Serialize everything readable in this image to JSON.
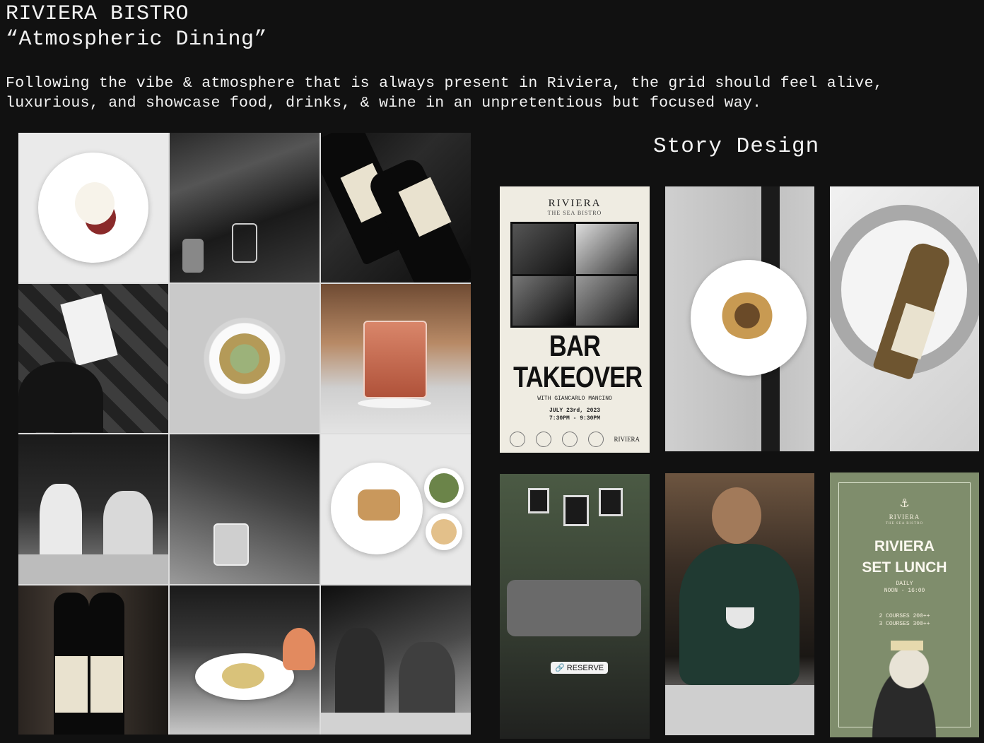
{
  "header": {
    "title": "RIVIERA BISTRO",
    "subtitle": "“Atmospheric Dining”",
    "description_line1": "Following the vibe & atmosphere that is always present in Riviera, the grid should feel alive,",
    "description_line2": "luxurious, and showcase food, drinks, & wine in an unpretentious but focused way."
  },
  "story": {
    "title": "Story Design",
    "bar_takeover": {
      "brand": "RIVIERA",
      "sub": "THE SEA BISTRO",
      "headline_1": "BAR",
      "headline_2": "TAKEOVER",
      "with": "WITH GIANCARLO MANCINO",
      "date": "JULY 23rd, 2023",
      "time": "7:30PM - 9:30PM",
      "logo_text": "RIVIERA"
    },
    "reserve_label": "RESERVE",
    "set_lunch": {
      "brand": "RIVIERA",
      "brand_sub": "THE SEA BISTRO",
      "headline_1": "RIVIERA",
      "headline_2": "SET LUNCH",
      "daily": "DAILY",
      "hours": "NOON - 16:00",
      "course_1": "2 COURSES 200++",
      "course_2": "3 COURSES 300++"
    }
  },
  "icons": {
    "anchor": "anchor-icon",
    "link": "link-icon"
  }
}
